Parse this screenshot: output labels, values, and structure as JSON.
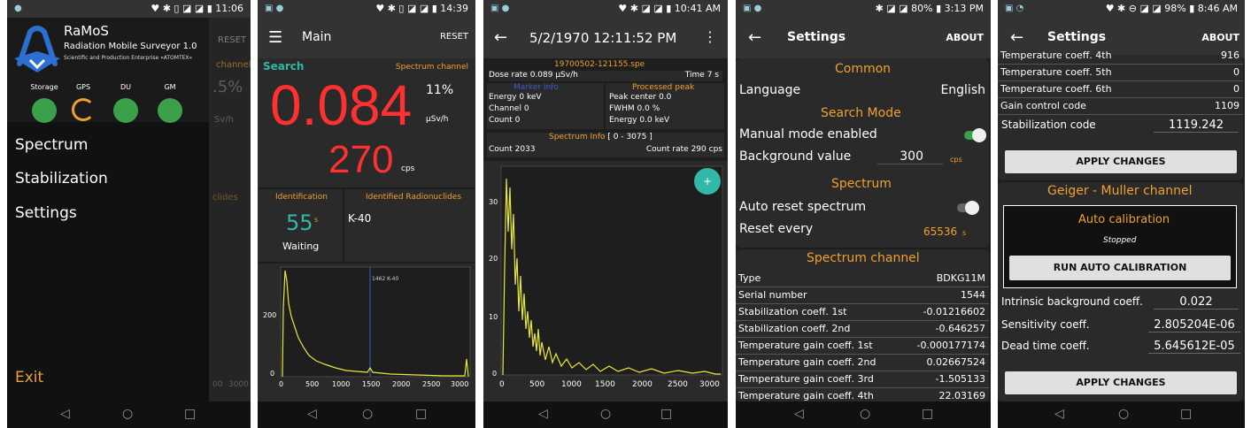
{
  "p1": {
    "status": {
      "time": "11:06"
    },
    "app": {
      "title": "RaMoS",
      "subtitle": "Radiation Mobile Surveyor 1.0",
      "company": "Scientific and Production Enterprise «ATOMTEX»"
    },
    "bg": {
      "reset": "RESET",
      "channel": "channel",
      "pct": ".5%",
      "unit": "Sv/h",
      "clides": "clides",
      "ticks": [
        "00",
        "3000"
      ]
    },
    "indicators": [
      {
        "label": "Storage",
        "state": "ok"
      },
      {
        "label": "GPS",
        "state": "search"
      },
      {
        "label": "DU",
        "state": "ok"
      },
      {
        "label": "GM",
        "state": "ok"
      }
    ],
    "menu": [
      "Spectrum",
      "Stabilization",
      "Settings"
    ],
    "exit": "Exit"
  },
  "p2": {
    "status": {
      "time": "14:39"
    },
    "title": "Main",
    "reset": "RESET",
    "search": "Search",
    "spectrum_channel": "Spectrum channel",
    "doserate": "0.084",
    "pct": "11%",
    "unit": "µSv/h",
    "countrate": "270",
    "cps": "cps",
    "identification": "Identification",
    "identified": "Identified Radionuclides",
    "time": "55",
    "time_unit": "s",
    "waiting": "Waiting",
    "nuclide": "K-40",
    "marker": "1462 K-40",
    "yticks": [
      "200",
      "0"
    ],
    "xticks": [
      "0",
      "500",
      "1000",
      "1500",
      "2000",
      "2500",
      "3000"
    ]
  },
  "p3": {
    "status": {
      "time": "10:41 AM"
    },
    "title": "5/2/1970 12:11:52 PM",
    "file": "19700502-121155.spe",
    "dose_label": "Dose rate",
    "dose_value": "0.089",
    "dose_unit": "µSv/h",
    "time_label": "Time",
    "time_value": "7",
    "time_unit": "s",
    "marker_head": "Marker info",
    "processed": "Processed peak",
    "energy": "Energy",
    "energy_v": "0",
    "kev": "keV",
    "channel": "Channel",
    "channel_v": "0",
    "count": "Count",
    "count_v": "0",
    "peak_center": "Peak center",
    "peak_center_v": "0.0",
    "fwhm": "FWHM",
    "fwhm_v": "0.0",
    "pct": "%",
    "energy2_v": "0.0",
    "spec_info": "Spectrum Info",
    "range": "[ 0 - 3075 ]",
    "count2": "Count",
    "count2_v": "2033",
    "countrate": "Count rate",
    "countrate_v": "290",
    "cps": "cps",
    "fab": "+",
    "yticks": [
      "30",
      "20",
      "10",
      "0"
    ],
    "xticks": [
      "0",
      "500",
      "1000",
      "1500",
      "2000",
      "2500",
      "3000"
    ]
  },
  "p4": {
    "status": {
      "batt": "80%",
      "time": "3:13 PM"
    },
    "title": "Settings",
    "about": "ABOUT",
    "common": "Common",
    "language": "Language",
    "language_v": "English",
    "search_mode": "Search Mode",
    "manual": "Manual mode enabled",
    "bg_value": "Background value",
    "bg_value_v": "300",
    "cps": "cps",
    "spectrum": "Spectrum",
    "auto_reset": "Auto reset spectrum",
    "reset_every": "Reset every",
    "reset_every_v": "65536",
    "s": "s",
    "spectrum_channel": "Spectrum channel",
    "rows": [
      [
        "Type",
        "BDKG11M"
      ],
      [
        "Serial number",
        "1544"
      ],
      [
        "Stabilization coeff. 1st",
        "-0.01216602"
      ],
      [
        "Stabilization coeff. 2nd",
        "-0.646257"
      ],
      [
        "Temperature gain coeff. 1st",
        "-0.000177174"
      ],
      [
        "Temperature gain coeff. 2nd",
        "0.02667524"
      ],
      [
        "Temperature gain coeff. 3rd",
        "-1.505133"
      ],
      [
        "Temperature gain coeff. 4th",
        "22.03169"
      ]
    ]
  },
  "p5": {
    "status": {
      "batt": "98%",
      "time": "8:46 AM"
    },
    "title": "Settings",
    "about": "ABOUT",
    "rows": [
      [
        "Temperature coeff. 4th",
        "916"
      ],
      [
        "Temperature coeff. 5th",
        "0"
      ],
      [
        "Temperature coeff. 6th",
        "0"
      ],
      [
        "Gain control code",
        "1109"
      ]
    ],
    "stab_code": "Stabilization code",
    "stab_code_v": "1119.242",
    "apply": "APPLY CHANGES",
    "gm_channel": "Geiger - Muller channel",
    "auto_cal": "Auto calibration",
    "stopped": "Stopped",
    "run_cal": "RUN AUTO CALIBRATION",
    "intrinsic": "Intrinsic background coeff.",
    "intrinsic_v": "0.022",
    "sensitivity": "Sensitivity coeff.",
    "sensitivity_v": "2.805204E-06",
    "dead": "Dead time coeff.",
    "dead_v": "5.645612E-05",
    "apply2": "APPLY CHANGES"
  },
  "colors": {
    "accent": "#f0a030",
    "red": "#ff3030",
    "teal": "#30b8a8",
    "green": "#3aa04a",
    "yellow": "#e8e838",
    "blue": "#3a5cc8"
  },
  "nav": {
    "back": "◁",
    "home": "○",
    "recent": "□"
  }
}
